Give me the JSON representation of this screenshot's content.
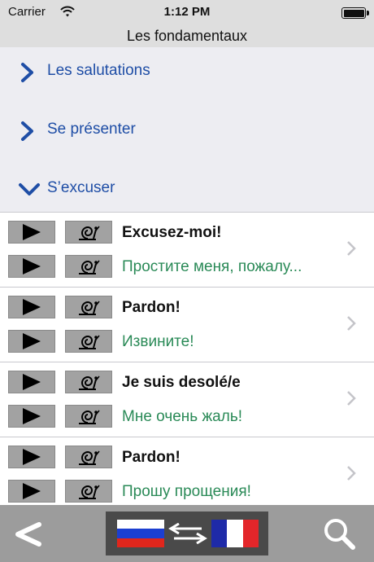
{
  "status": {
    "carrier": "Carrier",
    "time": "1:12 PM"
  },
  "nav": {
    "title": "Les fondamentaux"
  },
  "sections": [
    {
      "label": "Les salutations",
      "state": "collapsed"
    },
    {
      "label": "Se présenter",
      "state": "collapsed"
    },
    {
      "label": "S’excuser",
      "state": "expanded"
    }
  ],
  "phrases": [
    {
      "fr": "Excusez-moi!",
      "ru": "Простите меня, пожалу..."
    },
    {
      "fr": "Pardon!",
      "ru": "Извините!"
    },
    {
      "fr": "Je suis desolé/e",
      "ru": "Мне очень жаль!"
    },
    {
      "fr": "Pardon!",
      "ru": "Прошу прощения!"
    }
  ],
  "colors": {
    "section_text": "#1f4ea6",
    "translation_text": "#2a8a57",
    "toolbar_bg": "#9c9c9c"
  },
  "icons": {
    "play": "play-icon",
    "slow": "snail-icon",
    "back": "back-arrow-icon",
    "swap": "swap-arrows-icon",
    "search": "magnifier-icon"
  }
}
